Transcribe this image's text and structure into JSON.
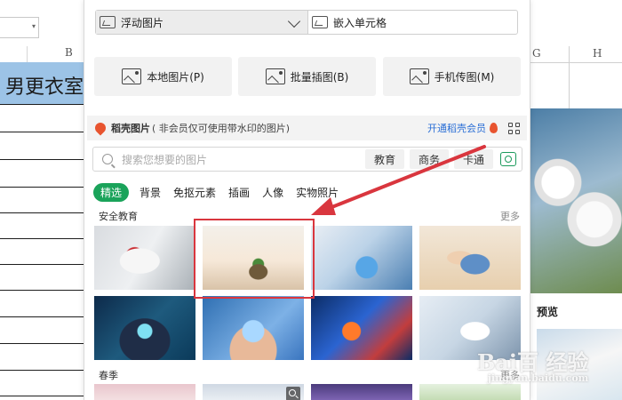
{
  "sheet": {
    "namebox_caret": "▾",
    "col_b": "B",
    "col_g": "G",
    "col_h": "H",
    "title_text": "男更衣室",
    "preview_label": "预览",
    "watermark": {
      "main": "Bai百 经验",
      "sub": "jingyan.baidu.com"
    }
  },
  "panel": {
    "insert_mode": {
      "floating": "浮动图片",
      "embed": "嵌入单元格"
    },
    "sources": [
      {
        "label": "本地图片(P)",
        "icon": "local-image-icon"
      },
      {
        "label": "批量插图(B)",
        "icon": "batch-insert-icon"
      },
      {
        "label": "手机传图(M)",
        "icon": "phone-upload-icon"
      }
    ],
    "daoke": {
      "title": "稻壳图片",
      "subtitle": "( 非会员仅可使用带水印的图片)",
      "member_link": "开通稻壳会员"
    },
    "search": {
      "placeholder": "搜索您想要的图片",
      "tags": [
        "教育",
        "商务",
        "卡通"
      ]
    },
    "categories": [
      "精选",
      "背景",
      "免抠元素",
      "插画",
      "人像",
      "实物照片"
    ],
    "sections": [
      {
        "title": "安全教育",
        "more": "更多"
      },
      {
        "title": "春季",
        "more": "更多"
      }
    ]
  },
  "colors": {
    "accent_green": "#1aa35a",
    "link_blue": "#2b6fd6",
    "highlight_red": "#d9363e",
    "header_blue": "#9cc3e6"
  }
}
